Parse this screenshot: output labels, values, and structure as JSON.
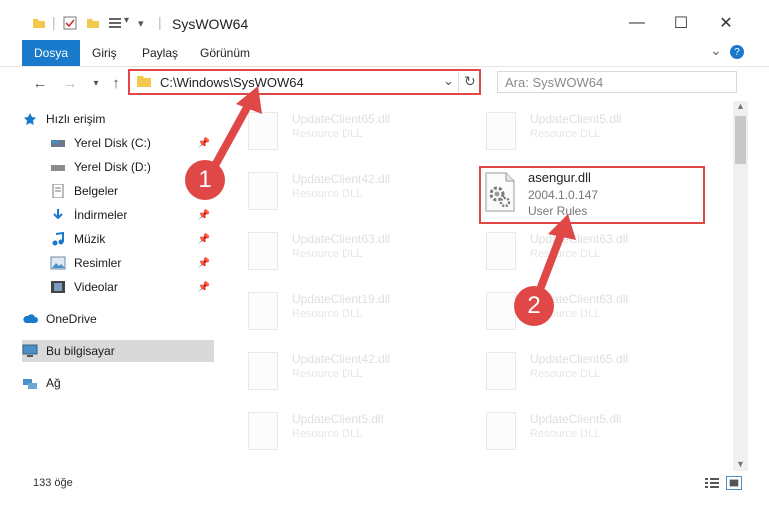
{
  "window": {
    "title": "SysWOW64",
    "minimize": "—",
    "maximize": "☐",
    "close": "✕"
  },
  "ribbon": {
    "tabs": [
      "Dosya",
      "Giriş",
      "Paylaş",
      "Görünüm"
    ],
    "collapse": "⌄",
    "help": "?"
  },
  "navigation": {
    "address": "C:\\Windows\\SysWOW64",
    "search_placeholder": "Ara: SysWOW64",
    "refresh": "↻",
    "dropdown": "⌄"
  },
  "sidebar": {
    "quick_access": "Hızlı erişim",
    "items": [
      {
        "label": "Yerel Disk (C:)",
        "pinned": true
      },
      {
        "label": "Yerel Disk (D:)",
        "pinned": false
      },
      {
        "label": "Belgeler",
        "pinned": true
      },
      {
        "label": "İndirmeler",
        "pinned": true
      },
      {
        "label": "Müzik",
        "pinned": true
      },
      {
        "label": "Resimler",
        "pinned": true
      },
      {
        "label": "Videolar",
        "pinned": true
      }
    ],
    "onedrive": "OneDrive",
    "this_pc": "Bu bilgisayar",
    "network": "Ağ"
  },
  "files": {
    "left": [
      {
        "name": "UpdateClient65.dll",
        "desc": "Resource DLL"
      },
      {
        "name": "UpdateClient42.dll",
        "desc": "Resource DLL"
      },
      {
        "name": "UpdateClient63.dll",
        "desc": "Resource DLL"
      },
      {
        "name": "UpdateClient19.dll",
        "desc": "Resource DLL"
      },
      {
        "name": "UpdateClient42.dll",
        "desc": "Resource DLL"
      },
      {
        "name": "UpdateClient5.dll",
        "desc": "Resource DLL"
      }
    ],
    "right": [
      {
        "name": "UpdateClient5.dll",
        "desc": "Resource DLL"
      },
      {
        "name": "asengur.dll",
        "version": "2004.1.0.147",
        "desc": "User Rules"
      },
      {
        "name": "UpdateClient63.dll",
        "desc": "Resource DLL"
      },
      {
        "name": "UpdateClient63.dll",
        "desc": "Resource DLL"
      },
      {
        "name": "UpdateClient65.dll",
        "desc": "Resource DLL"
      },
      {
        "name": "UpdateClient5.dll",
        "desc": "Resource DLL"
      }
    ]
  },
  "status": {
    "count": "133 öğe"
  },
  "callouts": [
    "1",
    "2"
  ],
  "colors": {
    "accent": "#1979ca",
    "highlight": "#e04848"
  }
}
